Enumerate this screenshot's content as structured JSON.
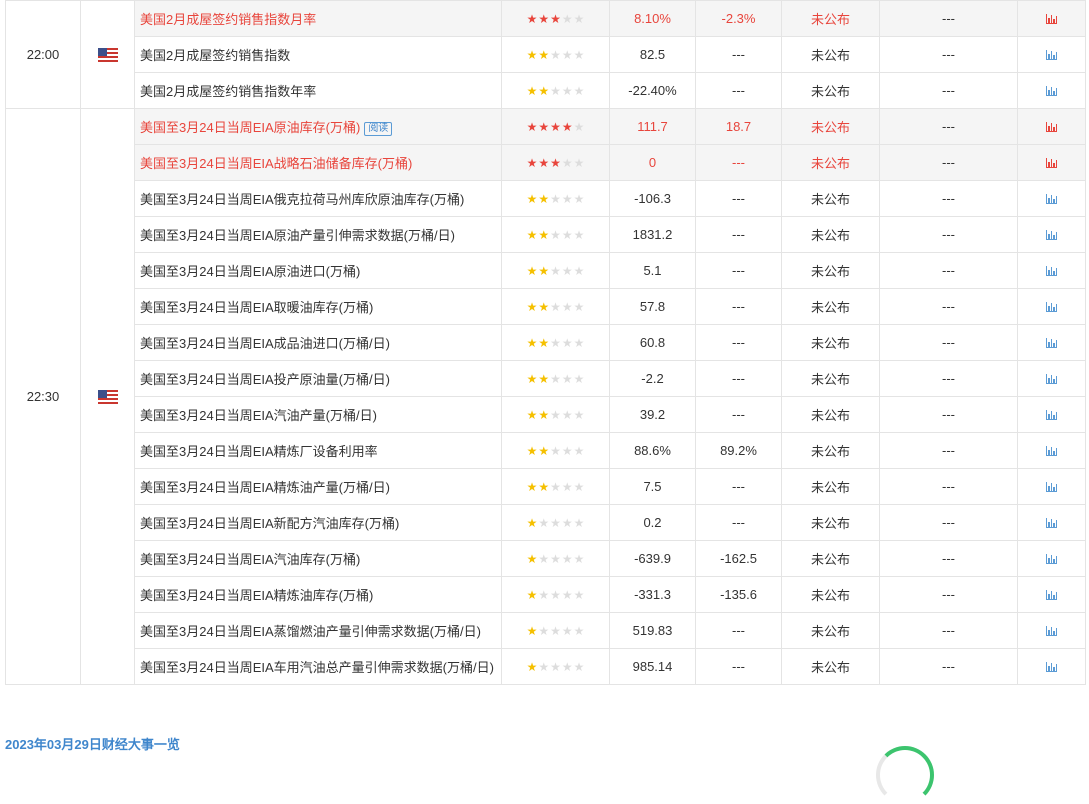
{
  "groups": [
    {
      "time": "22:00",
      "flag": "us-flag-icon",
      "rows": [
        {
          "indicator": "美国2月成屋签约销售指数月率",
          "badge": "",
          "stars": 3,
          "previous": "8.10%",
          "forecast": "-2.3%",
          "actual": "未公布",
          "extra": "---",
          "highlight": true
        },
        {
          "indicator": "美国2月成屋签约销售指数",
          "badge": "",
          "stars": 2,
          "previous": "82.5",
          "forecast": "---",
          "actual": "未公布",
          "extra": "---",
          "highlight": false
        },
        {
          "indicator": "美国2月成屋签约销售指数年率",
          "badge": "",
          "stars": 2,
          "previous": "-22.40%",
          "forecast": "---",
          "actual": "未公布",
          "extra": "---",
          "highlight": false
        }
      ]
    },
    {
      "time": "22:30",
      "flag": "us-flag-icon",
      "rows": [
        {
          "indicator": "美国至3月24日当周EIA原油库存(万桶)",
          "badge": "阅读",
          "stars": 4,
          "previous": "111.7",
          "forecast": "18.7",
          "actual": "未公布",
          "extra": "---",
          "highlight": true
        },
        {
          "indicator": "美国至3月24日当周EIA战略石油储备库存(万桶)",
          "badge": "",
          "stars": 3,
          "previous": "0",
          "forecast": "---",
          "actual": "未公布",
          "extra": "---",
          "highlight": true
        },
        {
          "indicator": "美国至3月24日当周EIA俄克拉荷马州库欣原油库存(万桶)",
          "badge": "",
          "stars": 2,
          "previous": "-106.3",
          "forecast": "---",
          "actual": "未公布",
          "extra": "---",
          "highlight": false
        },
        {
          "indicator": "美国至3月24日当周EIA原油产量引伸需求数据(万桶/日)",
          "badge": "",
          "stars": 2,
          "previous": "1831.2",
          "forecast": "---",
          "actual": "未公布",
          "extra": "---",
          "highlight": false
        },
        {
          "indicator": "美国至3月24日当周EIA原油进口(万桶)",
          "badge": "",
          "stars": 2,
          "previous": "5.1",
          "forecast": "---",
          "actual": "未公布",
          "extra": "---",
          "highlight": false
        },
        {
          "indicator": "美国至3月24日当周EIA取暖油库存(万桶)",
          "badge": "",
          "stars": 2,
          "previous": "57.8",
          "forecast": "---",
          "actual": "未公布",
          "extra": "---",
          "highlight": false
        },
        {
          "indicator": "美国至3月24日当周EIA成品油进口(万桶/日)",
          "badge": "",
          "stars": 2,
          "previous": "60.8",
          "forecast": "---",
          "actual": "未公布",
          "extra": "---",
          "highlight": false
        },
        {
          "indicator": "美国至3月24日当周EIA投产原油量(万桶/日)",
          "badge": "",
          "stars": 2,
          "previous": "-2.2",
          "forecast": "---",
          "actual": "未公布",
          "extra": "---",
          "highlight": false
        },
        {
          "indicator": "美国至3月24日当周EIA汽油产量(万桶/日)",
          "badge": "",
          "stars": 2,
          "previous": "39.2",
          "forecast": "---",
          "actual": "未公布",
          "extra": "---",
          "highlight": false
        },
        {
          "indicator": "美国至3月24日当周EIA精炼厂设备利用率",
          "badge": "",
          "stars": 2,
          "previous": "88.6%",
          "forecast": "89.2%",
          "actual": "未公布",
          "extra": "---",
          "highlight": false
        },
        {
          "indicator": "美国至3月24日当周EIA精炼油产量(万桶/日)",
          "badge": "",
          "stars": 2,
          "previous": "7.5",
          "forecast": "---",
          "actual": "未公布",
          "extra": "---",
          "highlight": false
        },
        {
          "indicator": "美国至3月24日当周EIA新配方汽油库存(万桶)",
          "badge": "",
          "stars": 1,
          "previous": "0.2",
          "forecast": "---",
          "actual": "未公布",
          "extra": "---",
          "highlight": false
        },
        {
          "indicator": "美国至3月24日当周EIA汽油库存(万桶)",
          "badge": "",
          "stars": 1,
          "previous": "-639.9",
          "forecast": "-162.5",
          "actual": "未公布",
          "extra": "---",
          "highlight": false
        },
        {
          "indicator": "美国至3月24日当周EIA精炼油库存(万桶)",
          "badge": "",
          "stars": 1,
          "previous": "-331.3",
          "forecast": "-135.6",
          "actual": "未公布",
          "extra": "---",
          "highlight": false
        },
        {
          "indicator": "美国至3月24日当周EIA蒸馏燃油产量引伸需求数据(万桶/日)",
          "badge": "",
          "stars": 1,
          "previous": "519.83",
          "forecast": "---",
          "actual": "未公布",
          "extra": "---",
          "highlight": false
        },
        {
          "indicator": "美国至3月24日当周EIA车用汽油总产量引伸需求数据(万桶/日)",
          "badge": "",
          "stars": 1,
          "previous": "985.14",
          "forecast": "---",
          "actual": "未公布",
          "extra": "---",
          "highlight": false
        }
      ]
    }
  ],
  "footer": {
    "title": "2023年03月29日财经大事一览"
  },
  "colors": {
    "highlight_text": "#e8453c",
    "link": "#3f86cc",
    "star_yellow": "#f5c000",
    "star_red": "#e8453c"
  }
}
